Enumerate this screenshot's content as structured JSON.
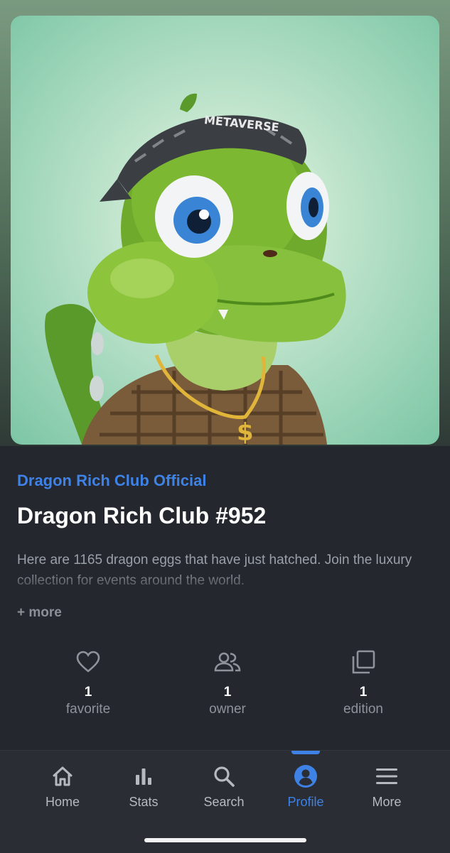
{
  "nft": {
    "collection": "Dragon Rich Club Official",
    "title": "Dragon Rich Club #952",
    "description": "Here are 1165 dragon eggs that have just hatched. Join the luxury collection for events around the world.",
    "more_label": "+ more",
    "bandana_text": "METAVERSE"
  },
  "stats": [
    {
      "count": "1",
      "label": "favorite",
      "icon": "heart-icon"
    },
    {
      "count": "1",
      "label": "owner",
      "icon": "people-icon"
    },
    {
      "count": "1",
      "label": "edition",
      "icon": "copies-icon"
    }
  ],
  "nav": {
    "items": [
      {
        "label": "Home",
        "icon": "home-icon"
      },
      {
        "label": "Stats",
        "icon": "bar-chart-icon"
      },
      {
        "label": "Search",
        "icon": "search-icon"
      },
      {
        "label": "Profile",
        "icon": "profile-icon"
      },
      {
        "label": "More",
        "icon": "menu-icon"
      }
    ],
    "active": "Profile"
  },
  "colors": {
    "accent": "#3f82e6",
    "background": "#24272d",
    "nav_background": "#2a2d33"
  }
}
